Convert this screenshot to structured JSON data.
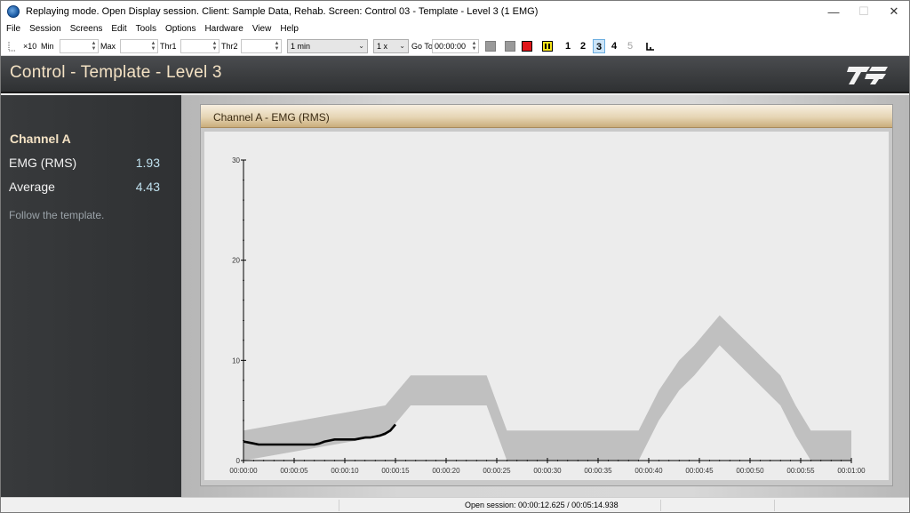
{
  "window": {
    "title": "Replaying mode. Open Display session. Client: Sample Data, Rehab. Screen: Control 03 - Template - Level 3 (1 EMG)",
    "minimize": "—",
    "maximize": "☐",
    "close": "✕"
  },
  "menu": [
    "File",
    "Session",
    "Screens",
    "Edit",
    "Tools",
    "Options",
    "Hardware",
    "View",
    "Help"
  ],
  "toolbar": {
    "x10": "×10",
    "min_label": "Min",
    "max_label": "Max",
    "thr1_label": "Thr1",
    "thr2_label": "Thr2",
    "timespan": "1 min",
    "speed": "1 x",
    "goto_label": "Go To",
    "goto_value": "00:00:00",
    "channels": [
      "1",
      "2",
      "3",
      "4",
      "5"
    ],
    "selected_channel": "3",
    "disabled_channel": "5",
    "stop_color": "#e0161a",
    "pause_color": "#f5e21a"
  },
  "header": {
    "title": "Control - Template - Level 3",
    "logo": "TT-logo"
  },
  "left_panel": {
    "channel_title": "Channel A",
    "rows": [
      {
        "label": "EMG (RMS)",
        "value": "1.93"
      },
      {
        "label": "Average",
        "value": "4.43"
      }
    ],
    "hint": "Follow the template."
  },
  "panel": {
    "title": "Channel A - EMG (RMS)"
  },
  "chart_data": {
    "type": "line",
    "title": "Channel A - EMG (RMS)",
    "xlabel": "",
    "ylabel": "",
    "xlim": [
      "00:00:00",
      "00:01:00"
    ],
    "ylim": [
      0,
      30
    ],
    "x_ticks": [
      "00:00:00",
      "00:00:05",
      "00:00:10",
      "00:00:15",
      "00:00:20",
      "00:00:25",
      "00:00:30",
      "00:00:35",
      "00:00:40",
      "00:00:45",
      "00:00:50",
      "00:00:55",
      "00:01:00"
    ],
    "y_ticks": [
      0,
      10,
      20,
      30
    ],
    "grid": false,
    "template_color": "#c0c0c0",
    "signal_color": "#000000",
    "template": {
      "name": "",
      "band_height": 3,
      "x_seconds": [
        0,
        14,
        16.5,
        24,
        26,
        39,
        41,
        43,
        44.5,
        47,
        50,
        51.5,
        53,
        54.5,
        56,
        60
      ],
      "center": [
        1.5,
        4,
        7,
        7,
        1.5,
        1.5,
        5.5,
        8.5,
        10,
        13,
        10,
        8.5,
        7,
        4,
        1.5,
        1.5
      ]
    },
    "signal": {
      "name": "EMG (RMS)",
      "x_seconds": [
        0,
        0.5,
        1,
        1.5,
        2,
        3,
        4,
        5,
        6,
        7,
        7.5,
        8,
        8.5,
        9,
        10,
        11,
        11.5,
        12,
        12.5,
        13,
        13.5,
        14,
        14.5,
        15
      ],
      "y": [
        1.9,
        1.8,
        1.7,
        1.6,
        1.6,
        1.6,
        1.6,
        1.6,
        1.6,
        1.6,
        1.7,
        1.9,
        2.0,
        2.1,
        2.1,
        2.1,
        2.2,
        2.3,
        2.3,
        2.4,
        2.5,
        2.7,
        3.0,
        3.6
      ]
    }
  },
  "status": {
    "text": "Open session: 00:00:12.625 / 00:05:14.938"
  }
}
